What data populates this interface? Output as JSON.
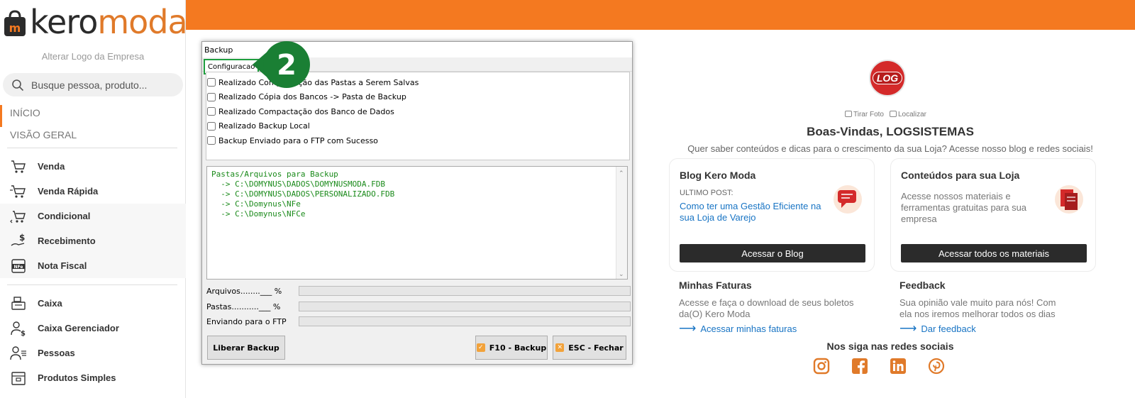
{
  "brand": {
    "logo_part1": "kero",
    "logo_part2": "moda",
    "accent": "#f47920"
  },
  "sidebar": {
    "alter_logo": "Alterar Logo da Empresa",
    "search_placeholder": "Busque pessoa, produto...",
    "nav_top": [
      {
        "label": "INÍCIO"
      },
      {
        "label": "VISÃO GERAL"
      }
    ],
    "group1": [
      {
        "label": "Venda",
        "icon": "cart-icon"
      },
      {
        "label": "Venda Rápida",
        "icon": "cart-fast-icon"
      },
      {
        "label": "Condicional",
        "icon": "cart-return-icon"
      },
      {
        "label": "Recebimento",
        "icon": "hand-money-icon"
      },
      {
        "label": "Nota Fiscal",
        "icon": "nfe-icon"
      }
    ],
    "group2": [
      {
        "label": "Caixa",
        "icon": "cash-register-icon"
      },
      {
        "label": "Caixa Gerenciador",
        "icon": "user-money-icon"
      },
      {
        "label": "Pessoas",
        "icon": "user-list-icon"
      },
      {
        "label": "Produtos Simples",
        "icon": "box-icon"
      }
    ]
  },
  "dialog": {
    "title": "Backup",
    "tab": "Configuracao",
    "step_badge": "2",
    "checks": [
      "Realizado Compactação das Pastas a Serem Salvas",
      "Realizado Cópia dos Bancos -> Pasta de Backup",
      "Realizado Compactação dos Banco de Dados",
      "Realizado Backup Local",
      "Backup Enviado para o FTP com Sucesso"
    ],
    "memo_lines": [
      "Pastas/Arquivos para Backup",
      "  -> C:\\DOMYNUS\\DADOS\\DOMYNUSMODA.FDB",
      "  -> C:\\DOMYNUS\\DADOS\\PERSONALIZADO.FDB",
      "  -> C:\\Domynus\\NFe",
      "  -> C:\\Domynus\\NFCe"
    ],
    "progress": [
      {
        "label": "Arquivos........___ %",
        "value": 0
      },
      {
        "label": "Pastas...........___ %",
        "value": 0
      },
      {
        "label": "Enviando para o FTP",
        "value": 0
      }
    ],
    "btn_liberar": "Liberar Backup",
    "btn_backup": "F10 - Backup",
    "btn_close": "ESC - Fechar"
  },
  "right": {
    "avatar_text": "LOG",
    "photo": "Tirar Foto",
    "locate": "Localizar",
    "welcome": "Boas-Vindas, LOGSISTEMAS",
    "welcome_sub": "Quer saber conteúdos e dicas para o crescimento da sua Loja? Acesse nosso blog e redes sociais!",
    "blog": {
      "title": "Blog Kero Moda",
      "small": "ULTIMO POST:",
      "post": "Como ter uma Gestão Eficiente na sua Loja de Varejo",
      "button": "Acessar o Blog"
    },
    "content": {
      "title": "Conteúdos para sua Loja",
      "desc": "Acesse nossos materiais e ferramentas gratuitas para sua empresa",
      "button": "Acessar todos os materiais"
    },
    "invoices": {
      "title": "Minhas Faturas",
      "desc": "Acesse e faça o download de seus boletos da(O) Kero Moda",
      "link": "Acessar minhas faturas"
    },
    "feedback": {
      "title": "Feedback",
      "desc": "Sua opinião vale muito para nós! Com ela nos iremos melhorar todos os dias",
      "link": "Dar feedback"
    },
    "social_title": "Nos siga nas redes sociais",
    "social": [
      "instagram-icon",
      "facebook-icon",
      "linkedin-icon",
      "pinterest-icon"
    ]
  }
}
